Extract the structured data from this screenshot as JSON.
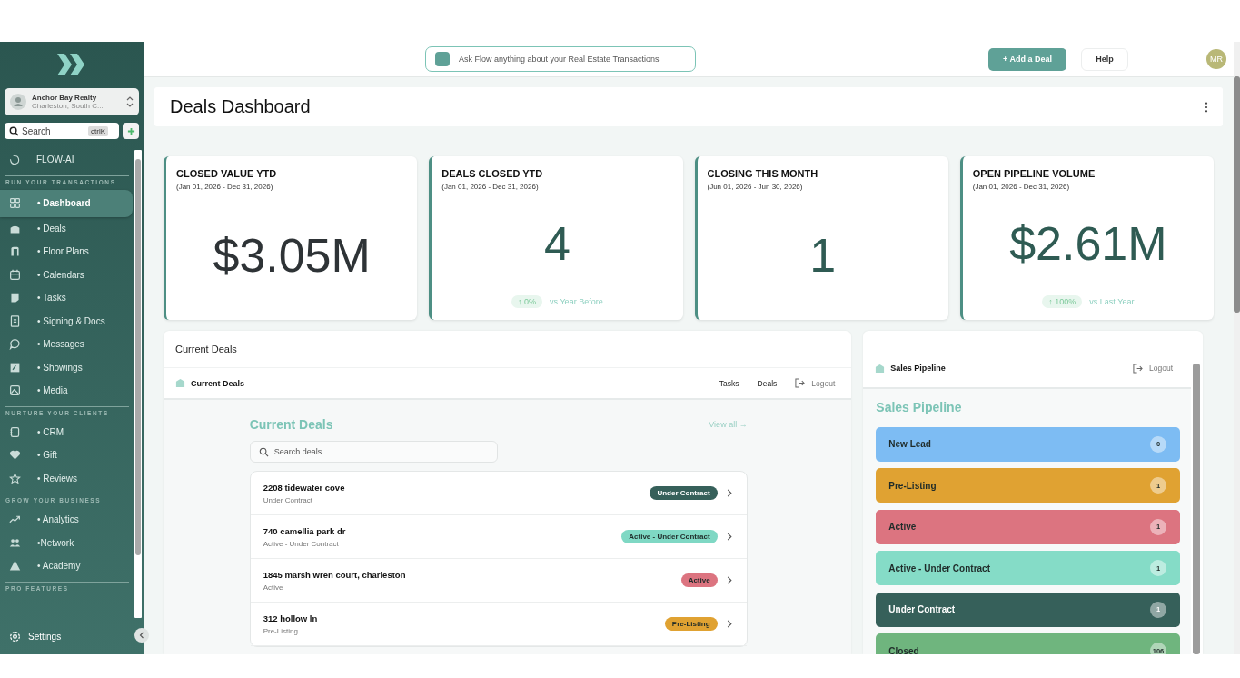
{
  "sidebar": {
    "org": {
      "name": "Anchor Bay Realty",
      "location": "Charleston, South C..."
    },
    "search": {
      "placeholder": "Search",
      "shortcut": "ctrlK"
    },
    "top_items": [
      {
        "label": "FLOW-AI",
        "selected": false
      }
    ],
    "sections": [
      {
        "heading": "RUN YOUR TRANSACTIONS",
        "items": [
          {
            "label": "• Dashboard",
            "selected": true
          },
          {
            "label": "• Deals",
            "selected": false
          },
          {
            "label": "• Floor Plans",
            "selected": false
          },
          {
            "label": "• Calendars",
            "selected": false
          },
          {
            "label": "• Tasks",
            "selected": false
          },
          {
            "label": "• Signing & Docs",
            "selected": false
          },
          {
            "label": "• Messages",
            "selected": false
          },
          {
            "label": "• Showings",
            "selected": false
          },
          {
            "label": "• Media",
            "selected": false
          }
        ]
      },
      {
        "heading": "NURTURE YOUR CLIENTS",
        "items": [
          {
            "label": "• CRM",
            "selected": false
          },
          {
            "label": "• Gift",
            "selected": false
          },
          {
            "label": "• Reviews",
            "selected": false
          }
        ]
      },
      {
        "heading": "GROW YOUR BUSINESS",
        "items": [
          {
            "label": "• Analytics",
            "selected": false
          },
          {
            "label": "•Network",
            "selected": false
          },
          {
            "label": "• Academy",
            "selected": false
          }
        ]
      },
      {
        "heading": "PRO FEATURES"
      }
    ],
    "settings": "Settings"
  },
  "topbar": {
    "ask_placeholder": "Ask Flow anything about your Real Estate Transactions",
    "add_button": "+ Add a Deal",
    "help_button": "Help",
    "avatar": "MR"
  },
  "page_title": "Deals Dashboard",
  "stats": [
    {
      "title": "CLOSED VALUE YTD",
      "range": "(Jan 01, 2026 - Dec 31, 2026)",
      "value": "$3.05M",
      "color": "#2e3336"
    },
    {
      "title": "DEALS CLOSED YTD",
      "range": "(Jan 01, 2026 - Dec 31, 2026)",
      "value": "4",
      "color": "#2f5b53",
      "trend": {
        "change": "↑ 0%",
        "text": "vs Year Before"
      }
    },
    {
      "title": "CLOSING THIS MONTH",
      "range": "(Jun 01, 2026 - Jun 30, 2026)",
      "value": "1",
      "color": "#2f5b53"
    },
    {
      "title": "OPEN PIPELINE VOLUME",
      "range": "(Jan 01, 2026 - Dec 31, 2026)",
      "value": "$2.61M",
      "color": "#2f5b53",
      "trend": {
        "change": "↑ 100%",
        "text": "vs Last Year"
      }
    }
  ],
  "current_deals": {
    "panel_title": "Current Deals",
    "header_title": "Current Deals",
    "tabs": [
      "Tasks",
      "Deals"
    ],
    "logout": "Logout",
    "title": "Current Deals",
    "view_all": "View all →",
    "search_placeholder": "Search deals...",
    "deals": [
      {
        "address": "2208 tidewater cove",
        "status": "Under Contract",
        "badge": "Under Contract",
        "color": "#36605a"
      },
      {
        "address": "740 camellia park dr",
        "status": "Active - Under Contract",
        "badge": "Active - Under Contract",
        "color": "#7fd8c4"
      },
      {
        "address": "1845 marsh wren court, charleston",
        "status": "Active",
        "badge": "Active",
        "color": "#dc7480"
      },
      {
        "address": "312 hollow ln",
        "status": "Pre-Listing",
        "badge": "Pre-Listing",
        "color": "#e0a232"
      }
    ]
  },
  "sales_pipeline": {
    "header_title": "Sales Pipeline",
    "logout": "Logout",
    "title": "Sales Pipeline",
    "stages": [
      {
        "label": "New Lead",
        "count": "0",
        "color": "#7dbcf3"
      },
      {
        "label": "Pre-Listing",
        "count": "1",
        "color": "#e0a232"
      },
      {
        "label": "Active",
        "count": "1",
        "color": "#dc7480"
      },
      {
        "label": "Active - Under Contract",
        "count": "1",
        "color": "#85dcc7"
      },
      {
        "label": "Under Contract",
        "count": "1",
        "color": "#36605a"
      },
      {
        "label": "Closed",
        "count": "106",
        "color": "#6fb57e"
      }
    ]
  }
}
